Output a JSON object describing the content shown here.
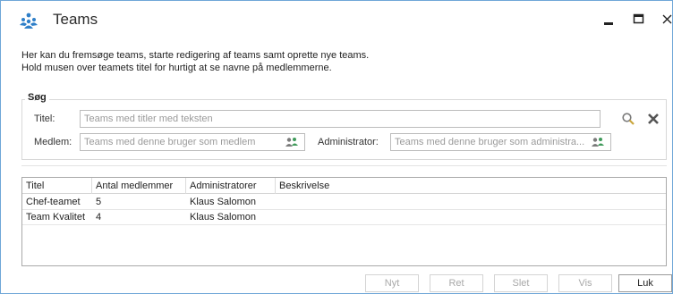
{
  "window": {
    "title": "Teams"
  },
  "intro": {
    "line1": "Her kan du fremsøge teams, starte redigering af teams samt oprette nye teams.",
    "line2": "Hold musen over teamets titel for hurtigt at se navne på medlemmerne."
  },
  "search": {
    "legend": "Søg",
    "title_label": "Titel:",
    "title_placeholder": "Teams med titler med teksten",
    "member_label": "Medlem:",
    "member_placeholder": "Teams med denne bruger som medlem",
    "admin_label": "Administrator:",
    "admin_placeholder": "Teams med denne bruger som administra..."
  },
  "grid": {
    "columns": [
      "Titel",
      "Antal medlemmer",
      "Administratorer",
      "Beskrivelse"
    ],
    "rows": [
      [
        "Chef-teamet",
        "5",
        "Klaus Salomon",
        ""
      ],
      [
        "Team Kvalitet",
        "4",
        "Klaus Salomon",
        ""
      ]
    ]
  },
  "buttons": {
    "new": "Nyt",
    "edit": "Ret",
    "delete": "Slet",
    "show": "Vis",
    "close": "Luk"
  },
  "colors": {
    "accent": "#2f7fc8",
    "border": "#6fa7d8"
  }
}
